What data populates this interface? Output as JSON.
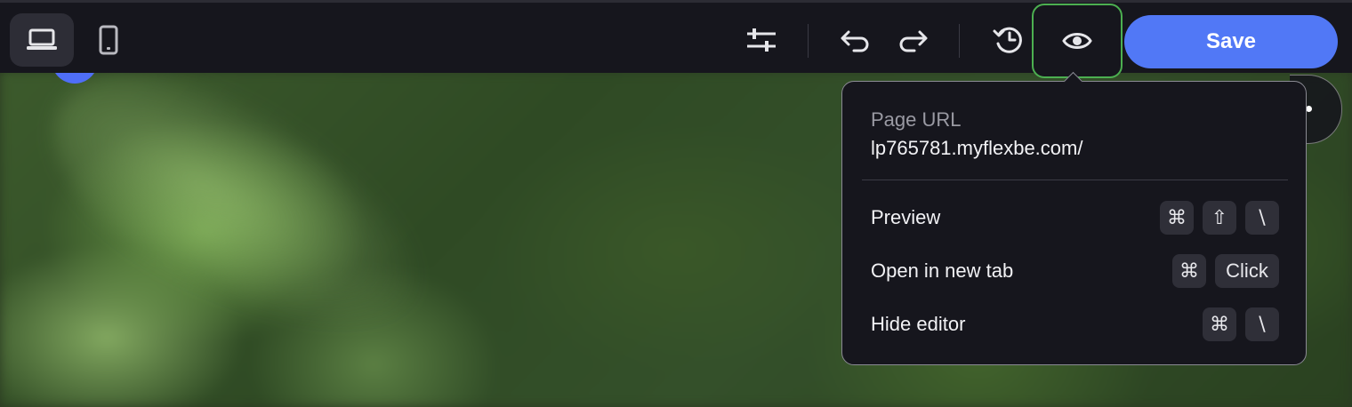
{
  "toolbar": {
    "device_desktop_icon": "laptop-icon",
    "device_mobile_icon": "phone-icon",
    "settings_icon": "sliders-icon",
    "undo_icon": "undo-icon",
    "redo_icon": "redo-icon",
    "history_icon": "history-icon",
    "preview_icon": "eye-icon",
    "save_label": "Save",
    "save_color": "#5178f6",
    "highlight_color": "#4caf50"
  },
  "popover": {
    "url_label": "Page URL",
    "url_value": "lp765781.myflexbe.com/",
    "items": [
      {
        "label": "Preview",
        "keys": [
          "⌘",
          "⇧",
          "\\"
        ]
      },
      {
        "label": "Open in new tab",
        "keys": [
          "⌘",
          "Click"
        ]
      },
      {
        "label": "Hide editor",
        "keys": [
          "⌘",
          "\\"
        ]
      }
    ]
  }
}
